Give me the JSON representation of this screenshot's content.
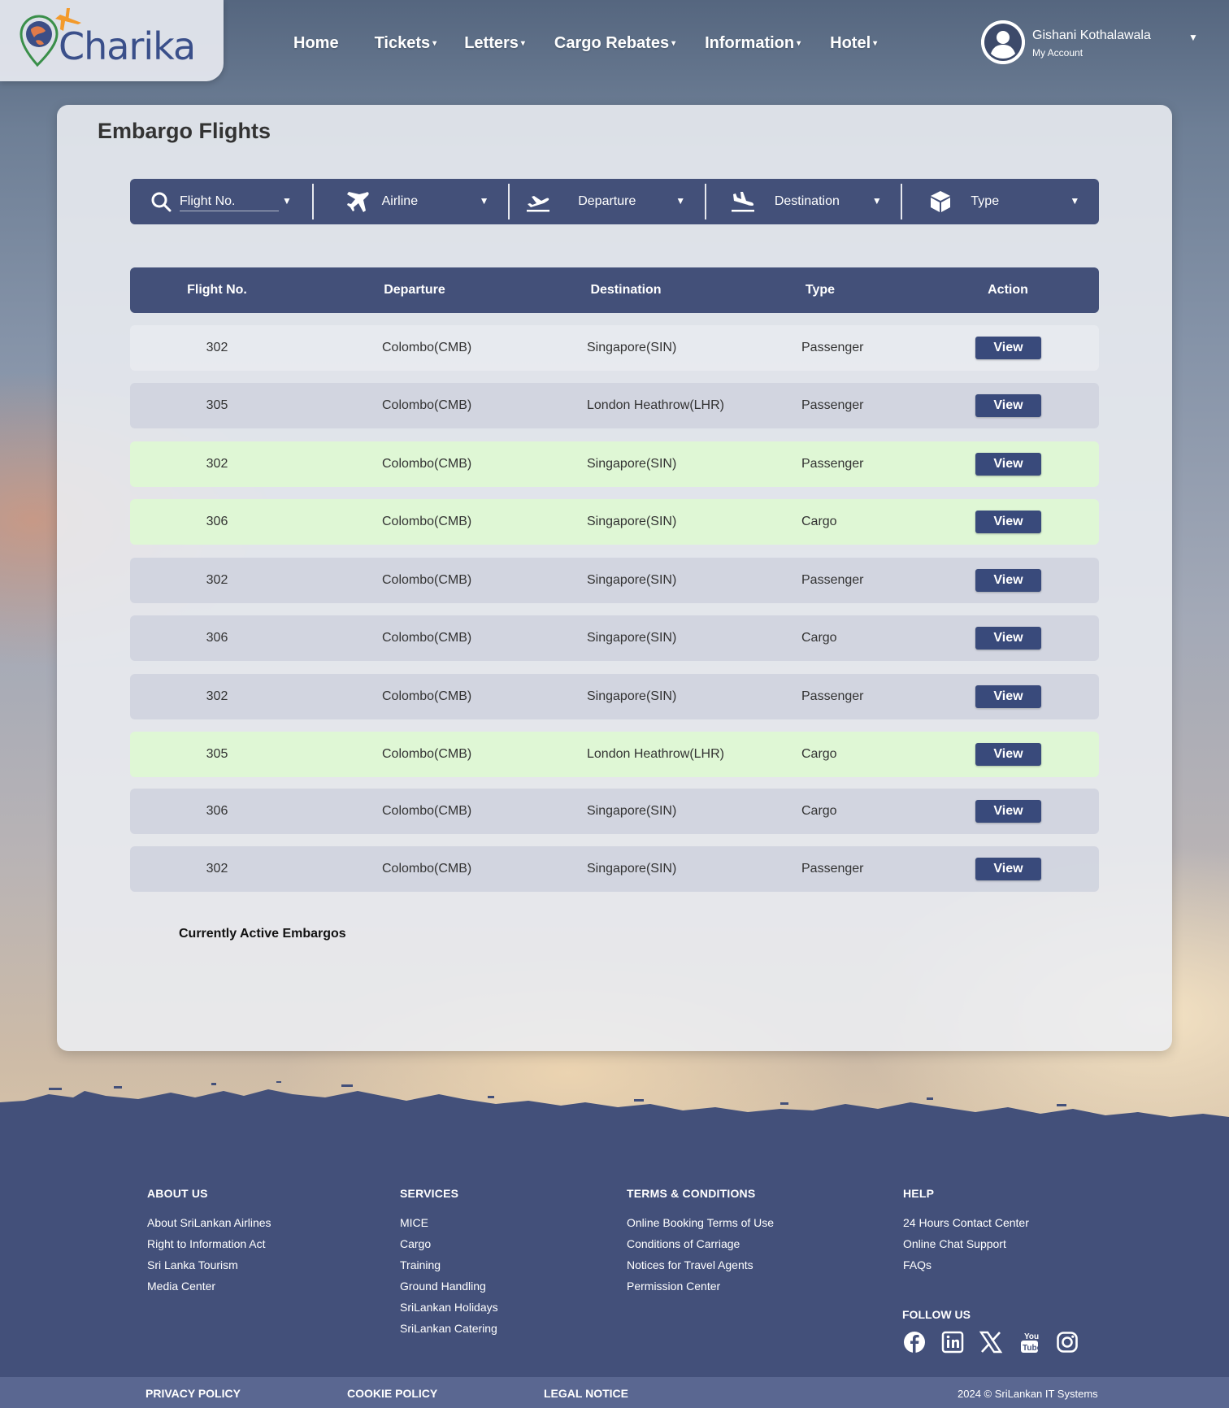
{
  "brand": {
    "name": "Charika",
    "colors": {
      "navy": "#435079",
      "orange": "#f39a2b",
      "green_row": "#def8d4"
    }
  },
  "nav": {
    "items": [
      {
        "label": "Home",
        "has_menu": false
      },
      {
        "label": "Tickets",
        "has_menu": true
      },
      {
        "label": "Letters",
        "has_menu": true
      },
      {
        "label": "Cargo Rebates",
        "has_menu": true
      },
      {
        "label": "Information",
        "has_menu": true
      },
      {
        "label": "Hotel",
        "has_menu": true
      }
    ],
    "caret": "▾"
  },
  "account": {
    "name": "Gishani Kothalawala",
    "subtitle": "My Account",
    "icon": "user-avatar-icon",
    "caret": "▼"
  },
  "page": {
    "title": "Embargo Flights"
  },
  "filters": [
    {
      "label": "Flight No.",
      "icon": "search-icon",
      "caret": "▼"
    },
    {
      "label": "Airline",
      "icon": "airplane-icon",
      "caret": "▼"
    },
    {
      "label": "Departure",
      "icon": "flight-takeoff-icon",
      "caret": "▼"
    },
    {
      "label": "Destination",
      "icon": "flight-land-icon",
      "caret": "▼"
    },
    {
      "label": "Type",
      "icon": "box-icon",
      "caret": "▼"
    }
  ],
  "table": {
    "headers": [
      "Flight No.",
      "Departure",
      "Destination",
      "Type",
      "Action"
    ],
    "rows": [
      {
        "flight": "302",
        "departure": "Colombo(CMB)",
        "destination": "Singapore(SIN)",
        "type": "Passenger",
        "action": "View",
        "shade": "white"
      },
      {
        "flight": "305",
        "departure": "Colombo(CMB)",
        "destination": "London Heathrow(LHR)",
        "type": "Passenger",
        "action": "View",
        "shade": "gray"
      },
      {
        "flight": "302",
        "departure": "Colombo(CMB)",
        "destination": "Singapore(SIN)",
        "type": "Passenger",
        "action": "View",
        "shade": "green"
      },
      {
        "flight": "306",
        "departure": "Colombo(CMB)",
        "destination": "Singapore(SIN)",
        "type": "Cargo",
        "action": "View",
        "shade": "green"
      },
      {
        "flight": "302",
        "departure": "Colombo(CMB)",
        "destination": "Singapore(SIN)",
        "type": "Passenger",
        "action": "View",
        "shade": "gray"
      },
      {
        "flight": "306",
        "departure": "Colombo(CMB)",
        "destination": "Singapore(SIN)",
        "type": "Cargo",
        "action": "View",
        "shade": "gray"
      },
      {
        "flight": "302",
        "departure": "Colombo(CMB)",
        "destination": "Singapore(SIN)",
        "type": "Passenger",
        "action": "View",
        "shade": "gray"
      },
      {
        "flight": "305",
        "departure": "Colombo(CMB)",
        "destination": "London Heathrow(LHR)",
        "type": "Cargo",
        "action": "View",
        "shade": "green"
      },
      {
        "flight": "306",
        "departure": "Colombo(CMB)",
        "destination": "Singapore(SIN)",
        "type": "Cargo",
        "action": "View",
        "shade": "gray"
      },
      {
        "flight": "302",
        "departure": "Colombo(CMB)",
        "destination": "Singapore(SIN)",
        "type": "Passenger",
        "action": "View",
        "shade": "gray"
      }
    ]
  },
  "active_embargos_label": "Currently Active Embargos",
  "footer": {
    "columns": [
      {
        "title": "ABOUT US",
        "links": [
          "About SriLankan Airlines",
          "Right to Information Act",
          "Sri Lanka Tourism",
          "Media Center"
        ]
      },
      {
        "title": "SERVICES",
        "links": [
          "MICE",
          "Cargo",
          "Training",
          "Ground Handling",
          "SriLankan Holidays",
          "SriLankan Catering"
        ]
      },
      {
        "title": "TERMS & CONDITIONS",
        "links": [
          "Online Booking Terms of Use",
          "Conditions of Carriage",
          "Notices for Travel Agents",
          "Permission Center"
        ]
      },
      {
        "title": "HELP",
        "links": [
          "24 Hours Contact Center",
          "Online Chat Support",
          "FAQs"
        ]
      }
    ],
    "follow_title": "FOLLOW US",
    "socials": [
      "facebook-icon",
      "linkedin-icon",
      "x-icon",
      "youtube-icon",
      "instagram-icon"
    ],
    "bottom_links": [
      "PRIVACY POLICY",
      "COOKIE POLICY",
      "LEGAL NOTICE"
    ],
    "copyright": "2024 © SriLankan IT Systems"
  }
}
